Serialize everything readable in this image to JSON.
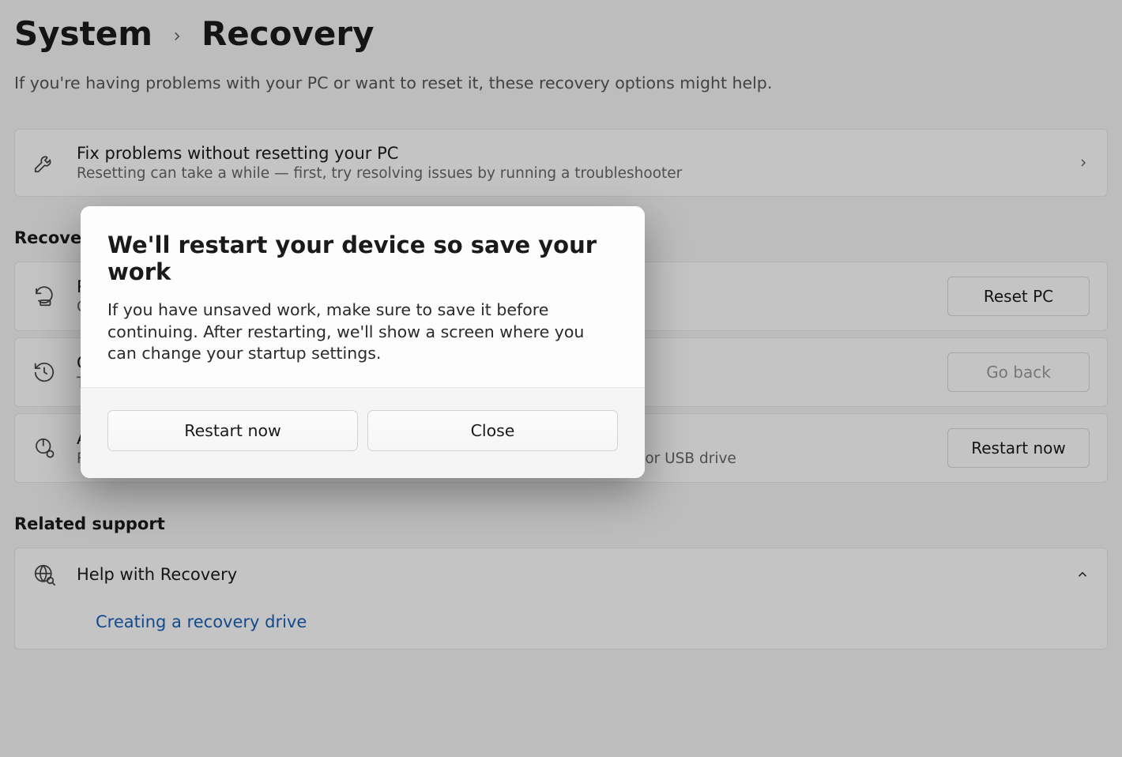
{
  "breadcrumb": {
    "parent": "System",
    "current": "Recovery"
  },
  "page_desc": "If you're having problems with your PC or want to reset it, these recovery options might help.",
  "fix": {
    "title": "Fix problems without resetting your PC",
    "sub": "Resetting can take a while — first, try resolving issues by running a troubleshooter"
  },
  "section_recovery": "Recovery options",
  "reset": {
    "title": "Reset this PC",
    "sub": "Choose to keep or remove your personal files, then reinstall Windows",
    "button": "Reset PC"
  },
  "goback": {
    "title": "Go back",
    "sub": "This option is no longer available on this PC",
    "button": "Go back"
  },
  "advanced": {
    "title": "Advanced startup",
    "sub": "Restart your device to change startup settings, including starting from a disc or USB drive",
    "button": "Restart now"
  },
  "section_support": "Related support",
  "help": {
    "title": "Help with Recovery"
  },
  "help_link": "Creating a recovery drive",
  "dialog": {
    "title": "We'll restart your device so save your work",
    "text": "If you have unsaved work, make sure to save it before continuing. After restarting, we'll show a screen where you can change your startup settings.",
    "restart": "Restart now",
    "close": "Close"
  }
}
